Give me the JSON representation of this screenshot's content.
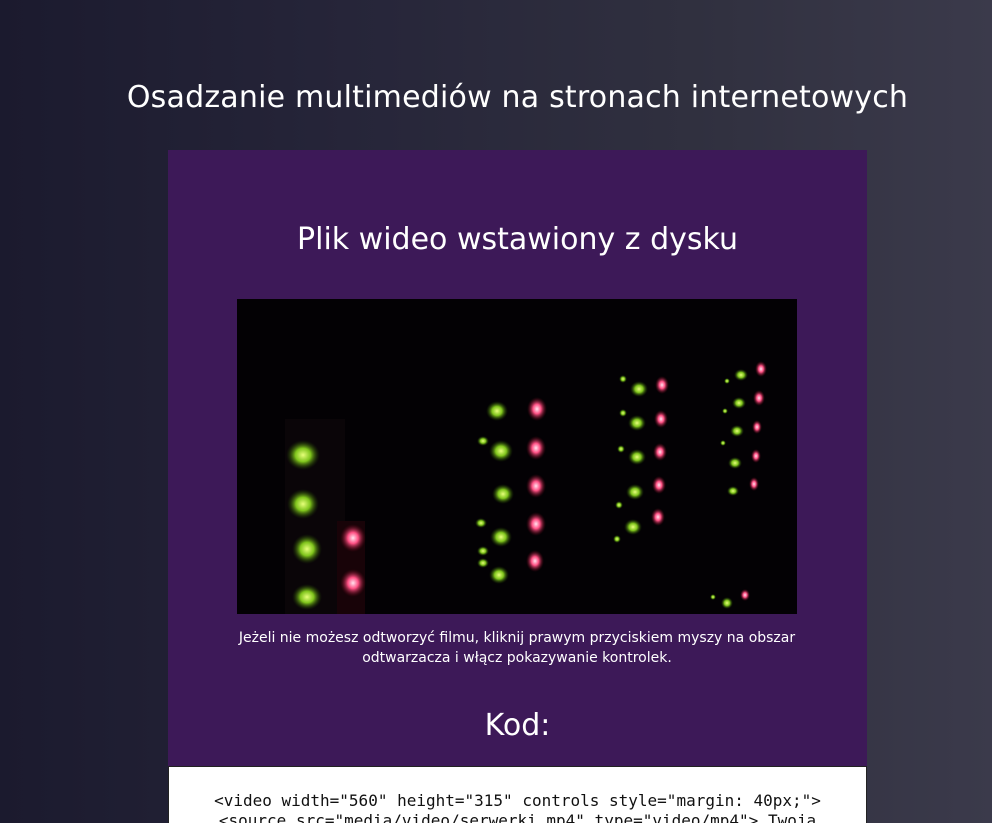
{
  "page": {
    "title": "Osadzanie multimediów na stronach internetowych"
  },
  "section": {
    "title": "Plik wideo wstawiony z dysku",
    "caption": "Jeżeli nie możesz odtworzyć filmu, kliknij prawym przyciskiem myszy na obszar odtwarzacza i włącz pokazywanie kontrolek.",
    "code_heading": "Kod:",
    "code_line_1": "<video width=\"560\" height=\"315\" controls style=\"margin: 40px;\">",
    "code_line_2": "<source src=\"media/video/serwerki.mp4\" type=\"video/mp4\"> Twoja"
  },
  "video": {
    "content": "server rack status lights (green and red)"
  },
  "colors": {
    "panel": "#3d1958",
    "led_green": "#8fd42a",
    "led_red": "#ff5a8a"
  }
}
